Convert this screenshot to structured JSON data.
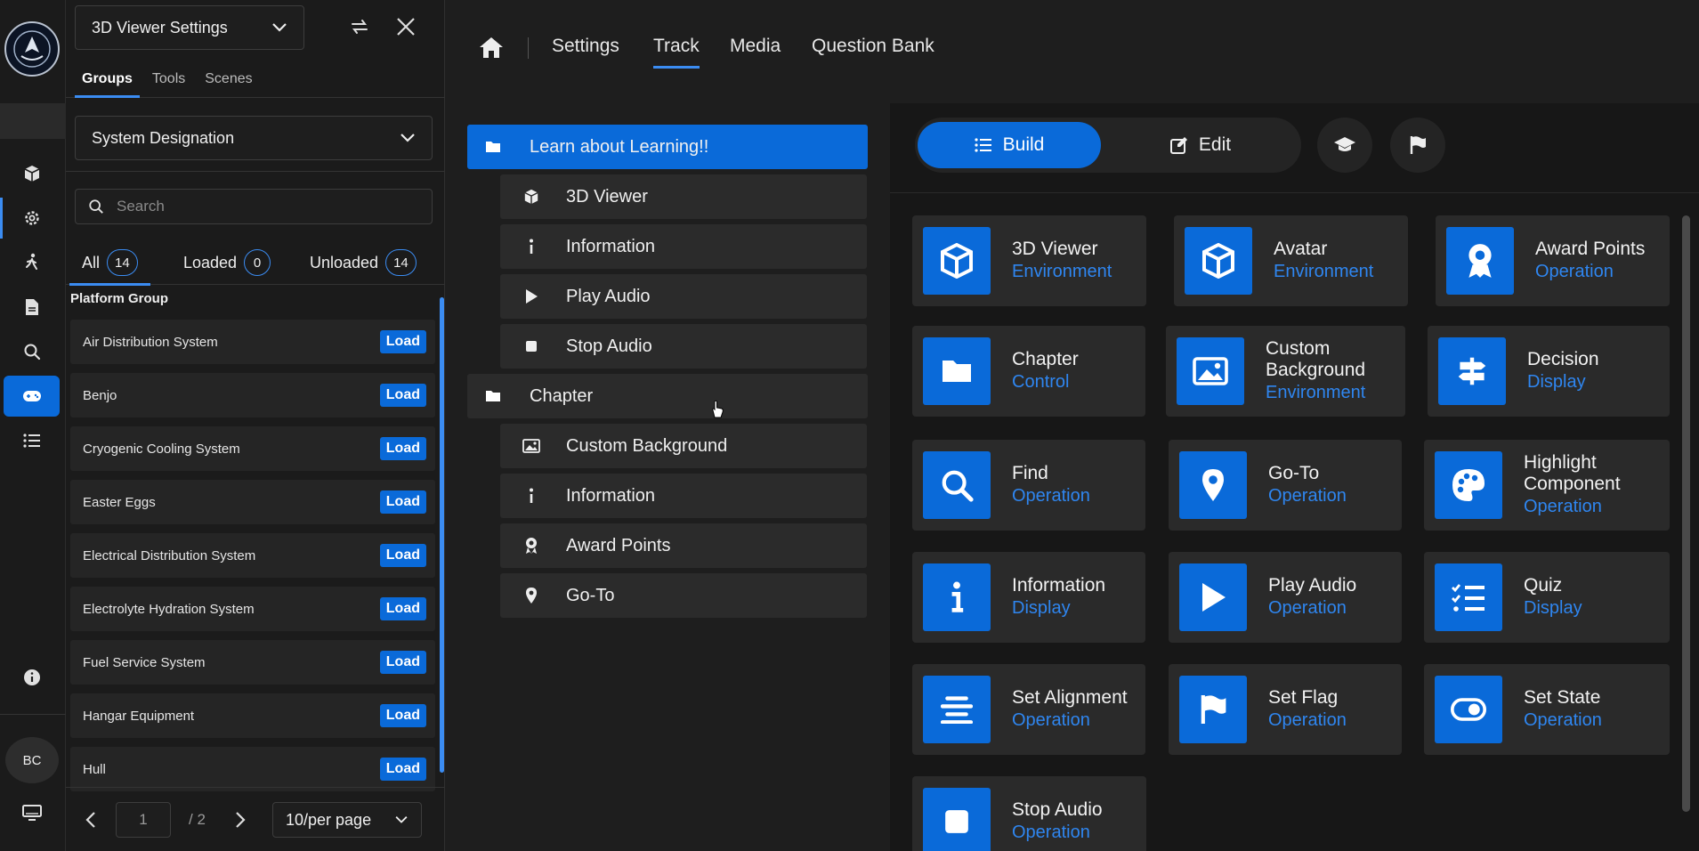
{
  "colors": {
    "accent": "#0a6ad9",
    "category": "#2f86f0",
    "bg": "#1e1e1e"
  },
  "rail": {
    "items": [
      "cube-icon",
      "gear-icon",
      "walk-icon",
      "document-icon",
      "search-icon",
      "gamepad-icon",
      "list-icon"
    ],
    "active": "gamepad-icon",
    "avatar_initials": "BC"
  },
  "panel": {
    "viewer_select": "3D Viewer Settings",
    "tabs": [
      "Groups",
      "Tools",
      "Scenes"
    ],
    "active_tab": "Groups",
    "designation_select": "System Designation",
    "search_placeholder": "Search",
    "filters": [
      {
        "label": "All",
        "count": "14"
      },
      {
        "label": "Loaded",
        "count": "0"
      },
      {
        "label": "Unloaded",
        "count": "14"
      }
    ],
    "group_title": "Platform Group",
    "load_label": "Load",
    "groups": [
      "Air Distribution System",
      "Benjo",
      "Cryogenic Cooling System",
      "Easter Eggs",
      "Electrical Distribution System",
      "Electrolyte Hydration System",
      "Fuel Service System",
      "Hangar Equipment",
      "Hull"
    ],
    "pager": {
      "page": "1",
      "total": "/ 2",
      "per_page": "10/per page"
    }
  },
  "nav": {
    "links": [
      "Settings",
      "Track",
      "Media",
      "Question Bank"
    ],
    "active": "Track"
  },
  "tree": {
    "chapters": [
      {
        "label": "Learn about Learning!!",
        "selected": true,
        "items": [
          {
            "label": "3D Viewer",
            "icon": "cube-icon"
          },
          {
            "label": "Information",
            "icon": "info-icon"
          },
          {
            "label": "Play Audio",
            "icon": "play-icon"
          },
          {
            "label": "Stop Audio",
            "icon": "stop-icon"
          }
        ]
      },
      {
        "label": "Chapter",
        "selected": false,
        "items": [
          {
            "label": "Custom Background",
            "icon": "image-icon"
          },
          {
            "label": "Information",
            "icon": "info-icon"
          },
          {
            "label": "Award Points",
            "icon": "award-icon"
          },
          {
            "label": "Go-To",
            "icon": "pin-icon"
          }
        ]
      }
    ]
  },
  "library": {
    "modes": [
      "Build",
      "Edit"
    ],
    "active_mode": "Build",
    "cards": [
      {
        "name": "3D Viewer",
        "category": "Environment",
        "icon": "cube-icon"
      },
      {
        "name": "Avatar",
        "category": "Environment",
        "icon": "cube-icon"
      },
      {
        "name": "Award Points",
        "category": "Operation",
        "icon": "award-icon"
      },
      {
        "name": "Chapter",
        "category": "Control",
        "icon": "folder-icon"
      },
      {
        "name": "Custom Background",
        "category": "Environment",
        "icon": "image-icon"
      },
      {
        "name": "Decision",
        "category": "Display",
        "icon": "signpost-icon"
      },
      {
        "name": "Find",
        "category": "Operation",
        "icon": "search-icon"
      },
      {
        "name": "Go-To",
        "category": "Operation",
        "icon": "pin-icon"
      },
      {
        "name": "Highlight Component",
        "category": "Operation",
        "icon": "palette-icon"
      },
      {
        "name": "Information",
        "category": "Display",
        "icon": "info-icon"
      },
      {
        "name": "Play Audio",
        "category": "Operation",
        "icon": "play-icon"
      },
      {
        "name": "Quiz",
        "category": "Display",
        "icon": "checklist-icon"
      },
      {
        "name": "Set Alignment",
        "category": "Operation",
        "icon": "align-icon"
      },
      {
        "name": "Set Flag",
        "category": "Operation",
        "icon": "flag-icon"
      },
      {
        "name": "Set State",
        "category": "Operation",
        "icon": "toggle-icon"
      },
      {
        "name": "Stop Audio",
        "category": "Operation",
        "icon": "stop-icon"
      }
    ]
  }
}
